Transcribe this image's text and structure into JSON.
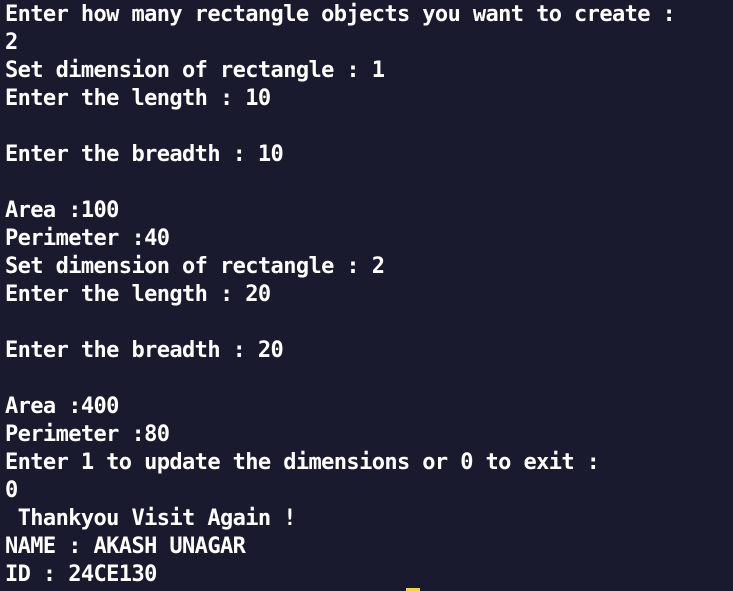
{
  "terminal": {
    "lines": [
      "Enter how many rectangle objects you want to create :",
      "2",
      "Set dimension of rectangle : 1",
      "Enter the length : 10",
      "",
      "Enter the breadth : 10",
      "",
      "Area :100",
      "Perimeter :40",
      "Set dimension of rectangle : 2",
      "Enter the length : 20",
      "",
      "Enter the breadth : 20",
      "",
      "Area :400",
      "Perimeter :80",
      "Enter 1 to update the dimensions or 0 to exit :",
      "0",
      " Thankyou Visit Again !",
      "NAME : AKASH UNAGAR",
      "ID : 24CE130"
    ],
    "colors": {
      "background": "#191a2e",
      "text": "#ffffff",
      "cursor": "#ffd23a"
    }
  }
}
